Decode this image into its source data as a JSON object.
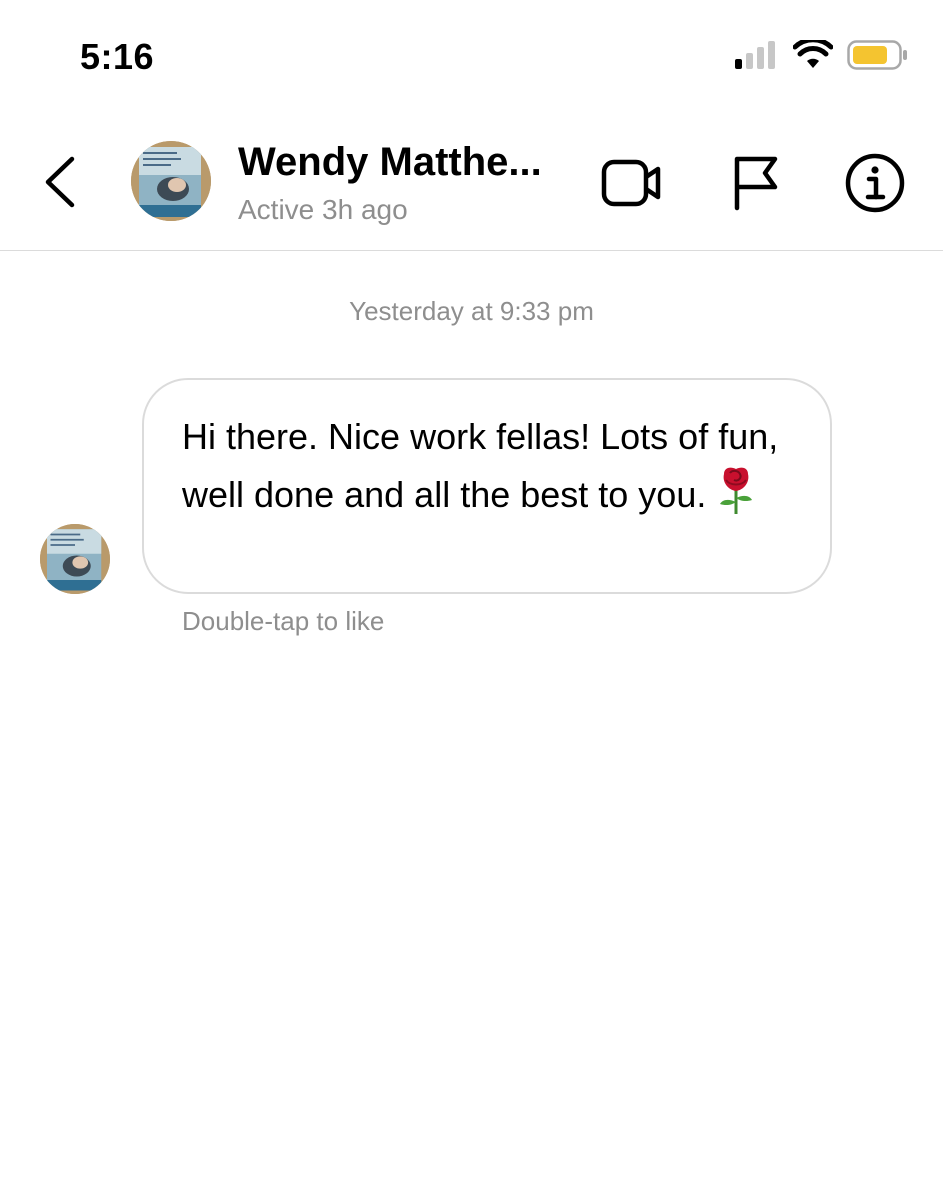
{
  "status_bar": {
    "time": "5:16"
  },
  "header": {
    "contact_name": "Wendy Matthe...",
    "contact_status": "Active 3h ago",
    "icons": [
      "back-chevron-icon",
      "video-camera-icon",
      "flag-icon",
      "info-icon"
    ]
  },
  "conversation": {
    "timestamp": "Yesterday at 9:33 pm",
    "messages": [
      {
        "text": "Hi there. Nice work fellas! Lots of fun, well done and all the best to you.",
        "emoji": "rose-emoji"
      }
    ],
    "hint": "Double-tap to like"
  },
  "colors": {
    "secondary_text": "#8e8e8e",
    "border": "#dbdbdb",
    "battery": "#f4c430"
  }
}
